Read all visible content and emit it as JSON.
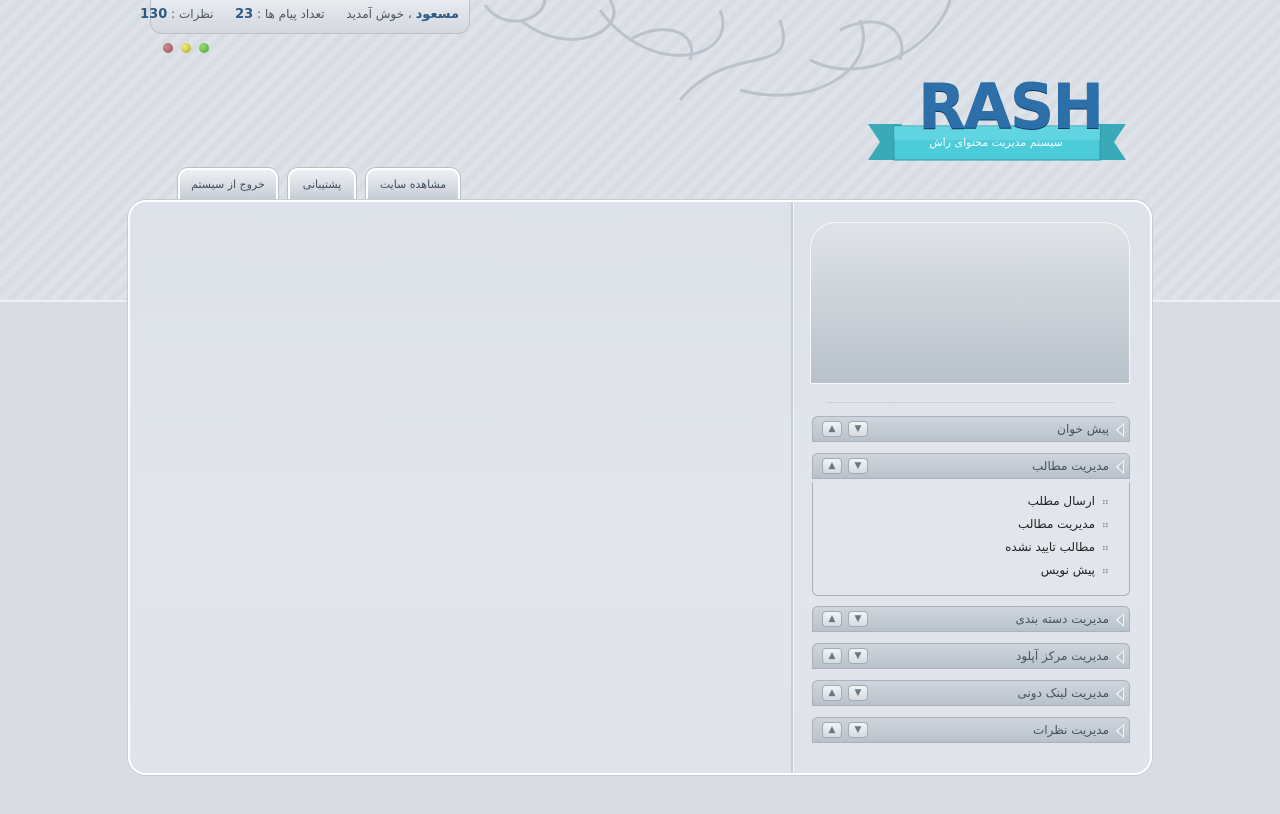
{
  "header": {
    "username": "مسعود",
    "welcome": "، خوش آمدید",
    "messages_label": "تعداد پیام ها :",
    "messages_count": "23",
    "comments_label": "نظرات :",
    "comments_count": "130",
    "status_dots": [
      "#5cb83c",
      "#c8c83a",
      "#a05a5a"
    ]
  },
  "logo": {
    "text": "RASH",
    "tagline": "سیستم مدیریت محتوای راش"
  },
  "tabs": [
    {
      "label": "مشاهده سایت"
    },
    {
      "label": "پشتیبانی"
    },
    {
      "label": "خروج از سیستم"
    }
  ],
  "sidebar": {
    "menus": [
      {
        "title": "پیش خوان"
      },
      {
        "title": "مدیریت مطالب",
        "items": [
          "ارسال مطلب",
          "مدیریت مطالب",
          "مطالب تایید نشده",
          "پیش نویس"
        ]
      },
      {
        "title": "مدیریت دسته بندی"
      },
      {
        "title": "مدیریت مرکز آپلود"
      },
      {
        "title": "مدیریت لینک دونی"
      },
      {
        "title": "مدیریت نظرات"
      }
    ],
    "controls": {
      "up": "▲",
      "down": "▼"
    }
  },
  "colors": {
    "accent": "#2d6fa8",
    "ribbon": "#3fc3d3"
  }
}
